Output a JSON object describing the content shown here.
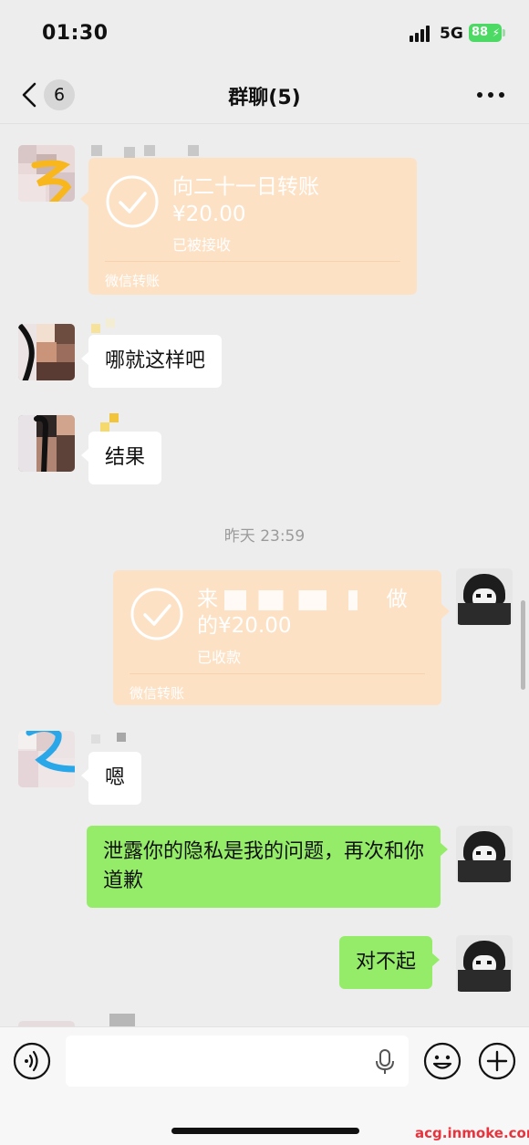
{
  "status_bar": {
    "time": "01:30",
    "network": "5G",
    "battery": "88"
  },
  "nav": {
    "unread_count": "6",
    "title": "群聊(5)"
  },
  "messages": {
    "transfer_received": {
      "title": "向二十一日转账",
      "amount": "¥20.00",
      "status": "已被接收",
      "footer": "微信转账"
    },
    "text_1": "哪就这样吧",
    "text_2": "结果",
    "time_divider": "昨天 23:59",
    "transfer_sent": {
      "title_prefix": "来",
      "title_suffix": "做",
      "amount": "的¥20.00",
      "status": "已收款",
      "footer": "微信转账"
    },
    "text_3": "嗯",
    "sent_1": "泄露你的隐私是我的问题，再次和你道歉",
    "sent_2": "对不起"
  },
  "input": {
    "placeholder": ""
  },
  "watermark": "acg.inmoke.com",
  "colors": {
    "background": "#ededed",
    "sent_bubble": "#95ec69",
    "transfer_card": "#fde1c5",
    "battery": "#4cd964"
  }
}
